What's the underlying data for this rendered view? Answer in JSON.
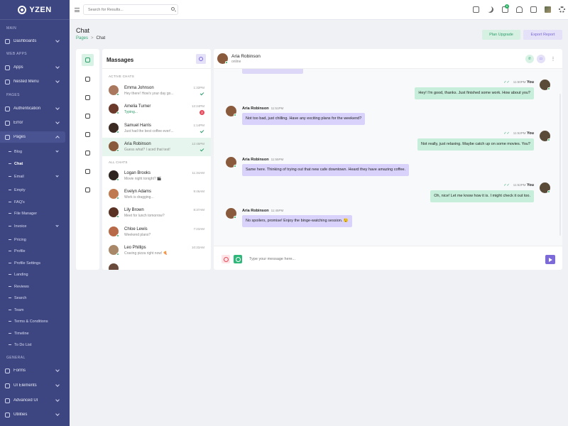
{
  "brand": {
    "name": "YZEN"
  },
  "sidebar": {
    "sections": {
      "main": "MAIN",
      "webapps": "WEB APPS",
      "pages": "PAGES",
      "general": "GENERAL"
    },
    "items": {
      "dashboards": "Dashboards",
      "apps": "Apps",
      "nested_menu": "Nested Menu",
      "authentication": "Authentication",
      "error": "Error",
      "pages": "Pages",
      "forms": "Forms",
      "ui_elements": "UI Elements",
      "advanced_ui": "Advanced UI",
      "utilities": "Utilities"
    },
    "sub": {
      "blog": "Blog",
      "chat": "Chat",
      "email": "Email",
      "empty": "Empty",
      "faqs": "FAQ's",
      "file_manager": "File Manager",
      "invoice": "Invoice",
      "pricing": "Pricing",
      "profile": "Profile",
      "profile_settings": "Profile Settings",
      "landing": "Landing",
      "reviews": "Reviews",
      "search": "Search",
      "team": "Team",
      "terms": "Terms & Conditions",
      "timeline": "Timeline",
      "todo": "To Do List"
    }
  },
  "header": {
    "search_placeholder": "Search for Results...",
    "cart_count": "6"
  },
  "page": {
    "title": "Chat",
    "breadcrumb": {
      "parent": "Pages",
      "separator": ">",
      "current": "Chat"
    },
    "plan_upgrade": "Plan Upgrade",
    "export_report": "Export Report"
  },
  "conversations": {
    "title": "Massages",
    "active_label": "ACTIVE CHATS",
    "all_label": "ALL CHATS",
    "active": [
      {
        "name": "Emma Johnson",
        "preview": "Hey there! How's your day go...",
        "time": "1:32PM"
      },
      {
        "name": "Amelia Turner",
        "preview": "Typing...",
        "time": "12:24PM",
        "unread": "2"
      },
      {
        "name": "Samuel Harris",
        "preview": "Just had the best coffee ever!...",
        "time": "1:14PM"
      },
      {
        "name": "Aria Robinson",
        "preview": "Guess what? I aced that test!",
        "time": "12:45PM"
      }
    ],
    "all": [
      {
        "name": "Logan Brooks",
        "preview": "Movie night tonight? 🎬",
        "time": "11:34AM"
      },
      {
        "name": "Evelyn Adams",
        "preview": "Work is dragging...",
        "time": "9:46AM"
      },
      {
        "name": "Lily Brown",
        "preview": "Meet for lunch tomorrow?",
        "time": "8:37AM"
      },
      {
        "name": "Chloe Lewis",
        "preview": "Weekend plans?",
        "time": "7:23AM"
      },
      {
        "name": "Leo Phillips",
        "preview": "Craving pizza right now! 🍕",
        "time": "10:33AM"
      }
    ]
  },
  "chat": {
    "contact": "Aria Robinson",
    "status": "online",
    "messages": [
      {
        "from": "You",
        "time": "11:50PM",
        "text": "Hey! I'm good, thanks. Just finished some work. How about you?"
      },
      {
        "from": "Aria Robinson",
        "time": "11:51PM",
        "text": "Not too bad, just chilling. Have any exciting plans for the weekend?"
      },
      {
        "from": "You",
        "time": "11:52PM",
        "text": "Not really, just relaxing. Maybe catch up on some movies. You?"
      },
      {
        "from": "Aria Robinson",
        "time": "11:55PM",
        "text": "Same here. Thinking of trying out that new cafe downtown. Heard they have amazing coffee."
      },
      {
        "from": "You",
        "time": "11:52PM",
        "text": "Oh, nice! Let me know how it is. I might check it out too."
      },
      {
        "from": "Aria Robinson",
        "time": "11:45PM",
        "text": "No spoilers, promise! Enjoy the binge-watching session. 😉"
      }
    ],
    "input_placeholder": "Type your message here..."
  },
  "colors": {
    "sidebar": "#3d4680",
    "accent_green": "#2d9d6a",
    "accent_purple": "#7b6ad8",
    "incoming_bubble": "#d9d3fb",
    "outgoing_bubble": "#c7eedb"
  }
}
